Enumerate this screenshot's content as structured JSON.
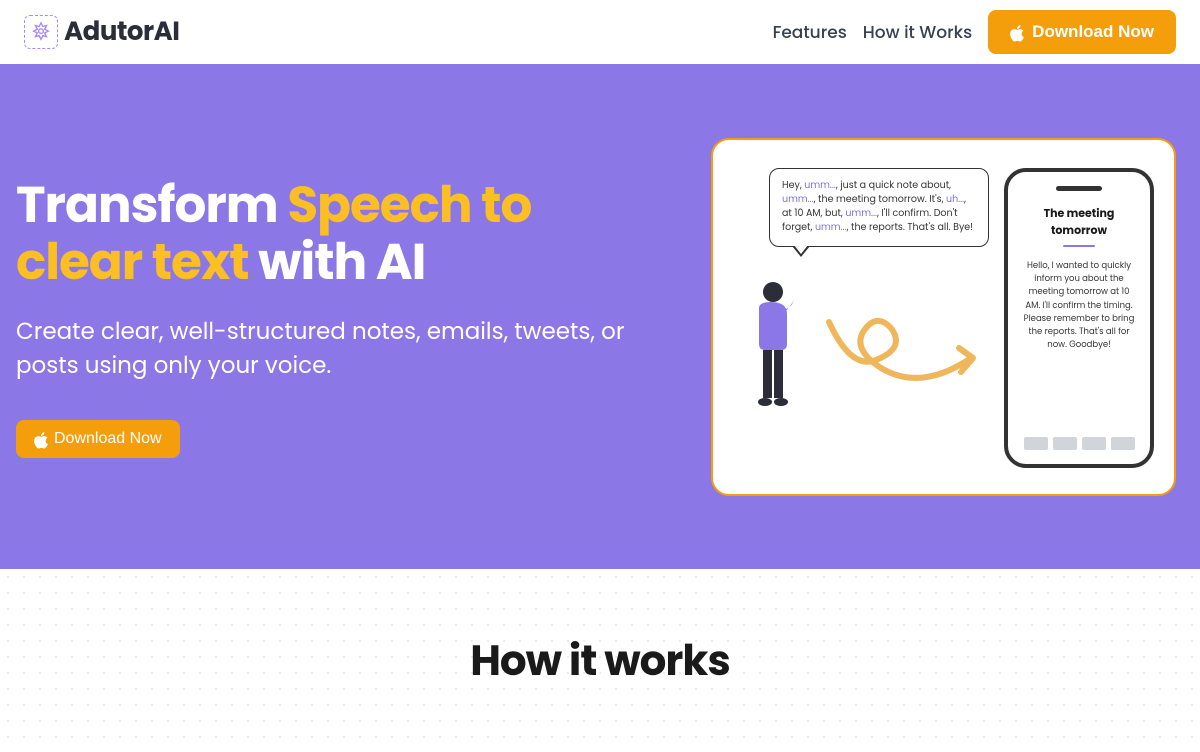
{
  "brand": {
    "name": "AdutorAI"
  },
  "nav": {
    "features": "Features",
    "how_it_works": "How it Works",
    "download": "Download Now"
  },
  "hero": {
    "title_pre": "Transform ",
    "title_accent": "Speech to clear text",
    "title_post": " with AI",
    "subtitle": "Create clear, well-structured notes, emails, tweets, or posts using only your voice.",
    "cta": "Download Now"
  },
  "illustration": {
    "speech": {
      "parts": [
        {
          "t": "Hey, "
        },
        {
          "t": "umm...",
          "f": true
        },
        {
          "t": ", just a quick note about, "
        },
        {
          "t": "umm...",
          "f": true
        },
        {
          "t": ", the meeting tomorrow. It's, "
        },
        {
          "t": "uh...",
          "f": true
        },
        {
          "t": ", at 10 AM, but, "
        },
        {
          "t": "umm...",
          "f": true
        },
        {
          "t": ", I'll confirm. Don't forget, "
        },
        {
          "t": "umm...",
          "f": true
        },
        {
          "t": ", the reports. That's all. Bye!"
        }
      ]
    },
    "phone": {
      "title": "The meeting tomorrow",
      "body": "Hello, I wanted to quickly inform you about the meeting tomorrow at 10 AM. I'll confirm the timing. Please remember to bring the reports. That's all for now. Goodbye!"
    }
  },
  "how": {
    "title": "How it works"
  },
  "colors": {
    "primary": "#8b78e6",
    "accent": "#f59e0b"
  }
}
